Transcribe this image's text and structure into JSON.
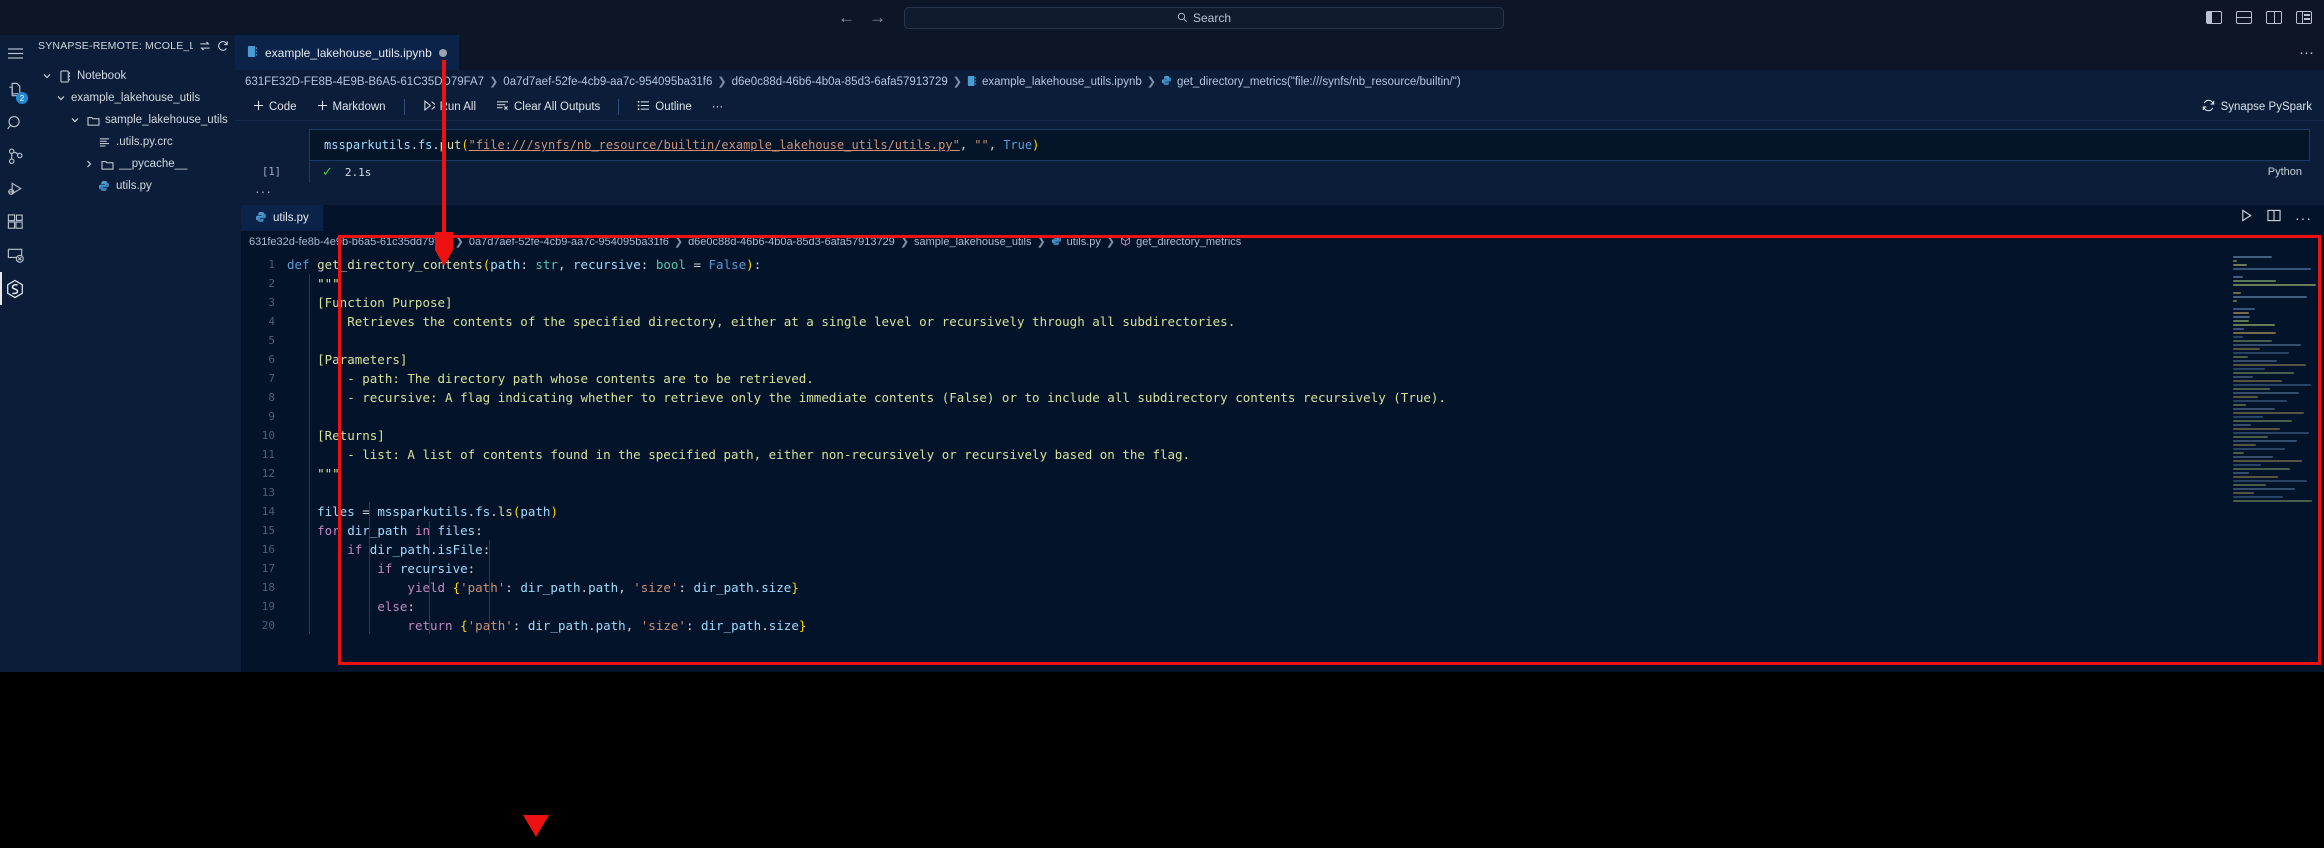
{
  "titlebar": {
    "back_icon": "arrow-left-icon",
    "forward_icon": "arrow-right-icon",
    "search_placeholder": "Search",
    "search_icon": "search-icon",
    "layout_icons": [
      "toggle-primary-sidebar-icon",
      "toggle-panel-icon",
      "toggle-secondary-sidebar-icon",
      "customize-layout-icon"
    ]
  },
  "activitybar": {
    "items": [
      {
        "name": "menu-icon",
        "label": "Menu",
        "badge": ""
      },
      {
        "name": "explorer-icon",
        "label": "Explorer",
        "badge": "2"
      },
      {
        "name": "search-icon",
        "label": "Search",
        "badge": ""
      },
      {
        "name": "source-control-icon",
        "label": "Source Control",
        "badge": ""
      },
      {
        "name": "run-and-debug-icon",
        "label": "Run and Debug",
        "badge": ""
      },
      {
        "name": "extensions-icon",
        "label": "Extensions",
        "badge": ""
      },
      {
        "name": "remote-explorer-icon",
        "label": "Remote Explorer",
        "badge": ""
      },
      {
        "name": "synapse-icon",
        "label": "Synapse",
        "badge": ""
      }
    ]
  },
  "sidebar": {
    "title": "SYNAPSE-REMOTE: MCOLE_LIBRARY_DE...",
    "action_switch": "switch-icon",
    "action_refresh": "refresh-icon",
    "tree": [
      {
        "label": "Notebook",
        "indent": 0,
        "chevron": "down",
        "icon": "notebook-icon"
      },
      {
        "label": "example_lakehouse_utils",
        "indent": 1,
        "chevron": "down",
        "icon": "none"
      },
      {
        "label": "sample_lakehouse_utils",
        "indent": 2,
        "chevron": "down",
        "icon": "folder-icon"
      },
      {
        "label": ".utils.py.crc",
        "indent": 4,
        "chevron": "none",
        "icon": "file-lines-icon"
      },
      {
        "label": "__pycache__",
        "indent": 3,
        "chevron": "right",
        "icon": "folder-icon"
      },
      {
        "label": "utils.py",
        "indent": 4,
        "chevron": "none",
        "icon": "python-icon"
      }
    ]
  },
  "editor": {
    "tab": {
      "label": "example_lakehouse_utils.ipynb",
      "icon": "notebook-icon",
      "dirty": true
    },
    "tab_more_icon": "ellipsis-icon",
    "breadcrumb": [
      "631FE32D-FE8B-4E9B-B6A5-61C35DD79FA7",
      "0a7d7aef-52fe-4cb9-aa7c-954095ba31f6",
      "d6e0c88d-46b6-4b0a-85d3-6afa57913729",
      "example_lakehouse_utils.ipynb",
      "get_directory_metrics(\"file:///synfs/nb_resource/builtin/\")"
    ],
    "toolbar": {
      "code_label": "Code",
      "markdown_label": "Markdown",
      "run_all_label": "Run All",
      "clear_all_outputs_label": "Clear All Outputs",
      "outline_label": "Outline",
      "more_label": "···",
      "kernel_label": "Synapse PySpark",
      "kernel_icon": "sync-icon"
    }
  },
  "notebook_cell": {
    "execution_count": "[1]",
    "status_check": "check-icon",
    "execution_time": "2.1s",
    "language": "Python",
    "dots": "···",
    "code_tokens": [
      {
        "t": "mssparkutils",
        "c": "vr"
      },
      {
        "t": ".",
        "c": "op"
      },
      {
        "t": "fs",
        "c": "vr"
      },
      {
        "t": ".",
        "c": "op"
      },
      {
        "t": "put",
        "c": "fn"
      },
      {
        "t": "(",
        "c": "pn"
      },
      {
        "t": "\"file:///synfs/nb_resource/builtin/example_lakehouse_utils/utils.py\"",
        "c": "lnk"
      },
      {
        "t": ", ",
        "c": "op"
      },
      {
        "t": "\"\"",
        "c": "st"
      },
      {
        "t": ", ",
        "c": "op"
      },
      {
        "t": "True",
        "c": "cn"
      },
      {
        "t": ")",
        "c": "pn"
      }
    ]
  },
  "py_editor": {
    "tab": {
      "label": "utils.py",
      "icon": "python-icon"
    },
    "actions": [
      "run-python-file-icon",
      "split-editor-icon",
      "ellipsis-icon"
    ],
    "breadcrumb": [
      "631fe32d-fe8b-4e9b-b6a5-61c35dd79fa7",
      "0a7d7aef-52fe-4cb9-aa7c-954095ba31f6",
      "d6e0c88d-46b6-4b0a-85d3-6afa57913729",
      "sample_lakehouse_utils",
      "utils.py",
      "get_directory_metrics"
    ],
    "line_numbers": [
      "1",
      "2",
      "3",
      "4",
      "5",
      "6",
      "7",
      "8",
      "9",
      "10",
      "11",
      "12",
      "13",
      "14",
      "15",
      "16",
      "17",
      "18",
      "19",
      "20"
    ],
    "lines": [
      [
        {
          "t": "def ",
          "c": "k"
        },
        {
          "t": "get_directory_contents",
          "c": "fn"
        },
        {
          "t": "(",
          "c": "pn"
        },
        {
          "t": "path",
          "c": "pm"
        },
        {
          "t": ": ",
          "c": "op"
        },
        {
          "t": "str",
          "c": "ty"
        },
        {
          "t": ", ",
          "c": "op"
        },
        {
          "t": "recursive",
          "c": "pm"
        },
        {
          "t": ": ",
          "c": "op"
        },
        {
          "t": "bool",
          "c": "ty"
        },
        {
          "t": " = ",
          "c": "op"
        },
        {
          "t": "False",
          "c": "cn"
        },
        {
          "t": ")",
          "c": "pn"
        },
        {
          "t": ":",
          "c": "op"
        }
      ],
      [
        {
          "t": "    \"\"\"",
          "c": "cm"
        }
      ],
      [
        {
          "t": "    [Function Purpose]",
          "c": "cm"
        }
      ],
      [
        {
          "t": "        Retrieves the contents of the specified directory, either at a single level or recursively through all subdirectories.",
          "c": "cm"
        }
      ],
      [
        {
          "t": "",
          "c": "cm"
        }
      ],
      [
        {
          "t": "    [Parameters]",
          "c": "cm"
        }
      ],
      [
        {
          "t": "        - path: The directory path whose contents are to be retrieved.",
          "c": "cm"
        }
      ],
      [
        {
          "t": "        - recursive: A flag indicating whether to retrieve only the immediate contents (False) or to include all subdirectory contents recursively (True).",
          "c": "cm"
        }
      ],
      [
        {
          "t": "",
          "c": "cm"
        }
      ],
      [
        {
          "t": "    [Returns]",
          "c": "cm"
        }
      ],
      [
        {
          "t": "        - list: A list of contents found in the specified path, either non-recursively or recursively based on the flag.",
          "c": "cm"
        }
      ],
      [
        {
          "t": "    \"\"\"",
          "c": "cm"
        }
      ],
      [
        {
          "t": "",
          "c": "op"
        }
      ],
      [
        {
          "t": "    ",
          "c": "op"
        },
        {
          "t": "files",
          "c": "pm"
        },
        {
          "t": " = ",
          "c": "op"
        },
        {
          "t": "mssparkutils",
          "c": "vr"
        },
        {
          "t": ".",
          "c": "op"
        },
        {
          "t": "fs",
          "c": "vr"
        },
        {
          "t": ".",
          "c": "op"
        },
        {
          "t": "ls",
          "c": "fn"
        },
        {
          "t": "(",
          "c": "pn"
        },
        {
          "t": "path",
          "c": "pm"
        },
        {
          "t": ")",
          "c": "pn"
        }
      ],
      [
        {
          "t": "    ",
          "c": "op"
        },
        {
          "t": "for ",
          "c": "kw"
        },
        {
          "t": "dir_path",
          "c": "pm"
        },
        {
          "t": " in ",
          "c": "kw"
        },
        {
          "t": "files",
          "c": "pm"
        },
        {
          "t": ":",
          "c": "op"
        }
      ],
      [
        {
          "t": "        ",
          "c": "op"
        },
        {
          "t": "if ",
          "c": "kw"
        },
        {
          "t": "dir_path",
          "c": "pm"
        },
        {
          "t": ".",
          "c": "op"
        },
        {
          "t": "isFile",
          "c": "vr"
        },
        {
          "t": ":",
          "c": "op"
        }
      ],
      [
        {
          "t": "            ",
          "c": "op"
        },
        {
          "t": "if ",
          "c": "kw"
        },
        {
          "t": "recursive",
          "c": "pm"
        },
        {
          "t": ":",
          "c": "op"
        }
      ],
      [
        {
          "t": "                ",
          "c": "op"
        },
        {
          "t": "yield ",
          "c": "kw"
        },
        {
          "t": "{",
          "c": "pn"
        },
        {
          "t": "'path'",
          "c": "st"
        },
        {
          "t": ": ",
          "c": "op"
        },
        {
          "t": "dir_path",
          "c": "pm"
        },
        {
          "t": ".",
          "c": "op"
        },
        {
          "t": "path",
          "c": "vr"
        },
        {
          "t": ", ",
          "c": "op"
        },
        {
          "t": "'size'",
          "c": "st"
        },
        {
          "t": ": ",
          "c": "op"
        },
        {
          "t": "dir_path",
          "c": "pm"
        },
        {
          "t": ".",
          "c": "op"
        },
        {
          "t": "size",
          "c": "vr"
        },
        {
          "t": "}",
          "c": "pn"
        }
      ],
      [
        {
          "t": "            ",
          "c": "op"
        },
        {
          "t": "else",
          "c": "kw"
        },
        {
          "t": ":",
          "c": "op"
        }
      ],
      [
        {
          "t": "                ",
          "c": "op"
        },
        {
          "t": "return ",
          "c": "kw"
        },
        {
          "t": "{",
          "c": "pn"
        },
        {
          "t": "'path'",
          "c": "st"
        },
        {
          "t": ": ",
          "c": "op"
        },
        {
          "t": "dir_path",
          "c": "pm"
        },
        {
          "t": ".",
          "c": "op"
        },
        {
          "t": "path",
          "c": "vr"
        },
        {
          "t": ", ",
          "c": "op"
        },
        {
          "t": "'size'",
          "c": "st"
        },
        {
          "t": ": ",
          "c": "op"
        },
        {
          "t": "dir_path",
          "c": "pm"
        },
        {
          "t": ".",
          "c": "op"
        },
        {
          "t": "size",
          "c": "vr"
        },
        {
          "t": "}",
          "c": "pn"
        }
      ]
    ]
  },
  "annotations": {
    "highlight_color": "#ee1111",
    "box_label": "highlight-box-around-utils-py-editor",
    "line_label": "vertical-pointer-line",
    "arrow_label": "down-arrow-pointer"
  }
}
